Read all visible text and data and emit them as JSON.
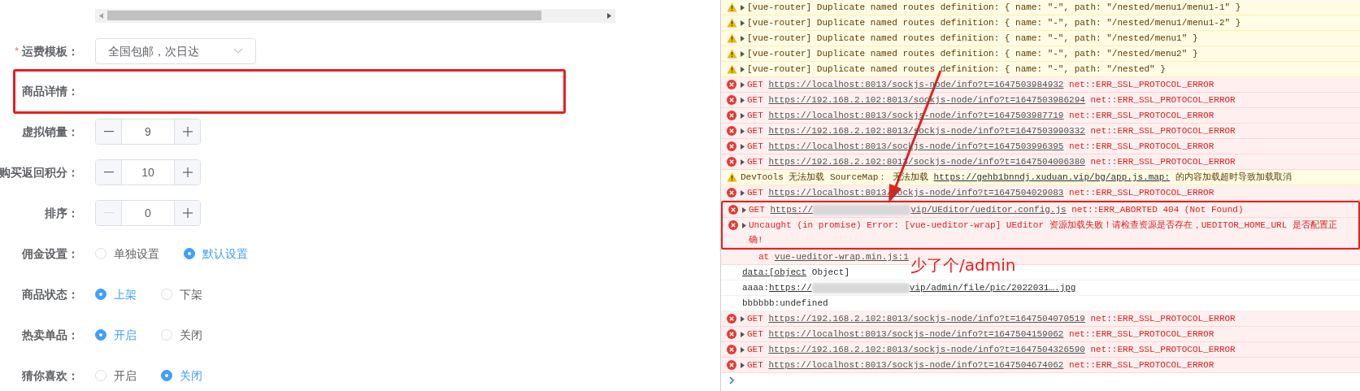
{
  "form": {
    "rows": [
      {
        "kind": "select",
        "label": "运费模板：",
        "required_mark": "*",
        "value": "全国包邮，次日达",
        "highlighted": false
      },
      {
        "kind": "empty",
        "label": "商品详情：",
        "highlighted": true
      },
      {
        "kind": "number",
        "label": "虚拟销量：",
        "value": "9",
        "decrement_disabled": false,
        "highlighted": false
      },
      {
        "kind": "number",
        "label": "购买返回积分：",
        "value": "10",
        "decrement_disabled": false,
        "highlighted": false
      },
      {
        "kind": "number",
        "label": "排序：",
        "value": "0",
        "decrement_disabled": true,
        "highlighted": false
      },
      {
        "kind": "radio",
        "label": "佣金设置：",
        "options": [
          {
            "label": "单独设置",
            "selected": false
          },
          {
            "label": "默认设置",
            "selected": true
          }
        ],
        "highlighted": false
      },
      {
        "kind": "radio",
        "label": "商品状态：",
        "options": [
          {
            "label": "上架",
            "selected": true
          },
          {
            "label": "下架",
            "selected": false
          }
        ],
        "highlighted": false
      },
      {
        "kind": "radio",
        "label": "热卖单品：",
        "options": [
          {
            "label": "开启",
            "selected": true
          },
          {
            "label": "关闭",
            "selected": false
          }
        ],
        "highlighted": false
      },
      {
        "kind": "radio",
        "label": "猜你喜欢：",
        "options": [
          {
            "label": "开启",
            "selected": false
          },
          {
            "label": "关闭",
            "selected": true
          }
        ],
        "highlighted": false
      }
    ]
  },
  "console": {
    "messages": [
      {
        "kind": "warning",
        "expandable": true,
        "highlighted": false,
        "parts": [
          {
            "kind": "text",
            "text": "[vue-router] Duplicate named routes definition: { name: \"-\", path: \"/nested/menu1/menu1-1\" }"
          }
        ]
      },
      {
        "kind": "warning",
        "expandable": true,
        "highlighted": false,
        "parts": [
          {
            "kind": "text",
            "text": "[vue-router] Duplicate named routes definition: { name: \"-\", path: \"/nested/menu1/menu1-2\" }"
          }
        ]
      },
      {
        "kind": "warning",
        "expandable": true,
        "highlighted": false,
        "parts": [
          {
            "kind": "text",
            "text": "[vue-router] Duplicate named routes definition: { name: \"-\", path: \"/nested/menu1\" }"
          }
        ]
      },
      {
        "kind": "warning",
        "expandable": true,
        "highlighted": false,
        "parts": [
          {
            "kind": "text",
            "text": "[vue-router] Duplicate named routes definition: { name: \"-\", path: \"/nested/menu2\" }"
          }
        ]
      },
      {
        "kind": "warning",
        "expandable": true,
        "highlighted": false,
        "parts": [
          {
            "kind": "text",
            "text": "[vue-router] Duplicate named routes definition: { name: \"-\", path: \"/nested\" }"
          }
        ]
      },
      {
        "kind": "error",
        "expandable": true,
        "highlighted": false,
        "parts": [
          {
            "kind": "text",
            "text": "GET"
          },
          {
            "kind": "link",
            "text": "https://localhost:8013/sockjs-node/info?t=1647503984932"
          },
          {
            "kind": "text",
            "text": "net::ERR_SSL_PROTOCOL_ERROR"
          }
        ]
      },
      {
        "kind": "error",
        "expandable": true,
        "highlighted": false,
        "parts": [
          {
            "kind": "text",
            "text": "GET"
          },
          {
            "kind": "link",
            "text": "https://192.168.2.102:8013/sockjs-node/info?t=1647503986294"
          },
          {
            "kind": "text",
            "text": "net::ERR_SSL_PROTOCOL_ERROR"
          }
        ]
      },
      {
        "kind": "error",
        "expandable": true,
        "highlighted": false,
        "parts": [
          {
            "kind": "text",
            "text": "GET"
          },
          {
            "kind": "link",
            "text": "https://localhost:8013/sockjs-node/info?t=1647503987719"
          },
          {
            "kind": "text",
            "text": "net::ERR_SSL_PROTOCOL_ERROR"
          }
        ]
      },
      {
        "kind": "error",
        "expandable": true,
        "highlighted": false,
        "parts": [
          {
            "kind": "text",
            "text": "GET"
          },
          {
            "kind": "link",
            "text": "https://192.168.2.102:8013/sockjs-node/info?t=1647503990332"
          },
          {
            "kind": "text",
            "text": "net::ERR_SSL_PROTOCOL_ERROR"
          }
        ]
      },
      {
        "kind": "error",
        "expandable": true,
        "highlighted": false,
        "parts": [
          {
            "kind": "text",
            "text": "GET"
          },
          {
            "kind": "link",
            "text": "https://localhost:8013/sockjs-node/info?t=1647503996395"
          },
          {
            "kind": "text",
            "text": "net::ERR_SSL_PROTOCOL_ERROR"
          }
        ]
      },
      {
        "kind": "error",
        "expandable": true,
        "highlighted": false,
        "parts": [
          {
            "kind": "text",
            "text": "GET"
          },
          {
            "kind": "link",
            "text": "https://192.168.2.102:8013/sockjs-node/info?t=1647504006380"
          },
          {
            "kind": "text",
            "text": "net::ERR_SSL_PROTOCOL_ERROR"
          }
        ]
      },
      {
        "kind": "warning",
        "expandable": false,
        "highlighted": false,
        "parts": [
          {
            "kind": "text",
            "text": "DevTools 无法加载 SourceMap："
          },
          {
            "kind": "text",
            "text": "无法加载"
          },
          {
            "kind": "link",
            "text": "https://gehb1bnndj.xuduan.vip/bg/app.js.map:"
          },
          {
            "kind": "text",
            "text": "的内容加载超时导致加载取消"
          }
        ]
      },
      {
        "kind": "error",
        "expandable": true,
        "highlighted": false,
        "parts": [
          {
            "kind": "text",
            "text": "GET"
          },
          {
            "kind": "link",
            "text": "https://localhost:8013/sockjs-node/info?t=1647504029083"
          },
          {
            "kind": "text",
            "text": "net::ERR_SSL_PROTOCOL_ERROR"
          }
        ]
      },
      {
        "kind": "error",
        "expandable": true,
        "highlighted": true,
        "parts": [
          {
            "kind": "text",
            "text": "GET"
          },
          {
            "kind": "link",
            "text": "https://"
          },
          {
            "kind": "redacted",
            "attached": true
          },
          {
            "kind": "link",
            "text": "vip/UEditor/ueditor.config.js",
            "attached": true
          },
          {
            "kind": "text",
            "text": "net::ERR_ABORTED 404 (Not Found)"
          }
        ]
      },
      {
        "kind": "error",
        "expandable": true,
        "highlighted": true,
        "parts": [
          {
            "kind": "text",
            "text": "Uncaught (in promise) Error: [vue-ueditor-wrap] UEditor 资源加载失败！请检查资源是否存在，UEDITOR_HOME_URL 是否配置正确!"
          }
        ]
      },
      {
        "kind": "stack",
        "expandable": false,
        "highlighted": false,
        "parts": [
          {
            "kind": "text",
            "text": "at"
          },
          {
            "kind": "link",
            "text": "vue-ueditor-wrap.min.js:1"
          }
        ]
      },
      {
        "kind": "log",
        "expandable": false,
        "highlighted": false,
        "parts": [
          {
            "kind": "link",
            "text": "data:[object"
          },
          {
            "kind": "text",
            "text": "Object]"
          }
        ]
      },
      {
        "kind": "log",
        "expandable": false,
        "highlighted": false,
        "parts": [
          {
            "kind": "text",
            "text": "aaaa:"
          },
          {
            "kind": "link",
            "text": "https://",
            "attached": true
          },
          {
            "kind": "redacted",
            "attached": true
          },
          {
            "kind": "link",
            "text": "vip/admin/file/pic/2022031….jpg",
            "attached": true
          }
        ]
      },
      {
        "kind": "log",
        "expandable": false,
        "highlighted": false,
        "parts": [
          {
            "kind": "text",
            "text": "bbbbbb:undefined"
          }
        ]
      },
      {
        "kind": "error",
        "expandable": true,
        "highlighted": false,
        "parts": [
          {
            "kind": "text",
            "text": "GET"
          },
          {
            "kind": "link",
            "text": "https://192.168.2.102:8013/sockjs-node/info?t=1647504070519"
          },
          {
            "kind": "text",
            "text": "net::ERR_SSL_PROTOCOL_ERROR"
          }
        ]
      },
      {
        "kind": "error",
        "expandable": true,
        "highlighted": false,
        "parts": [
          {
            "kind": "text",
            "text": "GET"
          },
          {
            "kind": "link",
            "text": "https://localhost:8013/sockjs-node/info?t=1647504159062"
          },
          {
            "kind": "text",
            "text": "net::ERR_SSL_PROTOCOL_ERROR"
          }
        ]
      },
      {
        "kind": "error",
        "expandable": true,
        "highlighted": false,
        "parts": [
          {
            "kind": "text",
            "text": "GET"
          },
          {
            "kind": "link",
            "text": "https://192.168.2.102:8013/sockjs-node/info?t=1647504326590"
          },
          {
            "kind": "text",
            "text": "net::ERR_SSL_PROTOCOL_ERROR"
          }
        ]
      },
      {
        "kind": "error",
        "expandable": true,
        "highlighted": false,
        "parts": [
          {
            "kind": "text",
            "text": "GET"
          },
          {
            "kind": "link",
            "text": "https://localhost:8013/sockjs-node/info?t=1647504674062"
          },
          {
            "kind": "text",
            "text": "net::ERR_SSL_PROTOCOL_ERROR"
          }
        ]
      },
      {
        "kind": "prompt",
        "expandable": false,
        "highlighted": false
      }
    ]
  },
  "annotation": {
    "note": "少了个/admin"
  }
}
